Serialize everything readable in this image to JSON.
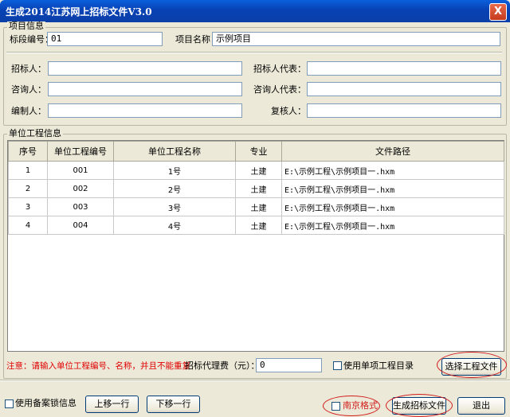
{
  "window": {
    "title": "生成2014江苏网上招标文件V3.0",
    "close_glyph": "X"
  },
  "project_info": {
    "legend": "项目信息",
    "section_no_label": "标段编号：",
    "section_no_value": "01",
    "project_name_label": "项目名称：",
    "project_name_value": "示例项目",
    "tenderer_label": "招标人：",
    "tenderer_value": "",
    "tenderer_rep_label": "招标人代表：",
    "tenderer_rep_value": "",
    "consultant_label": "咨询人：",
    "consultant_value": "",
    "consultant_rep_label": "咨询人代表：",
    "consultant_rep_value": "",
    "compiler_label": "编制人：",
    "compiler_value": "",
    "reviewer_label": "复核人：",
    "reviewer_value": ""
  },
  "unit_info": {
    "legend": "单位工程信息",
    "columns": [
      "序号",
      "单位工程编号",
      "单位工程名称",
      "专业",
      "文件路径"
    ],
    "rows": [
      [
        "1",
        "001",
        "1号",
        "土建",
        "E:\\示例工程\\示例项目一.hxm"
      ],
      [
        "2",
        "002",
        "2号",
        "土建",
        "E:\\示例工程\\示例项目一.hxm"
      ],
      [
        "3",
        "003",
        "3号",
        "土建",
        "E:\\示例工程\\示例项目一.hxm"
      ],
      [
        "4",
        "004",
        "4号",
        "土建",
        "E:\\示例工程\\示例项目一.hxm"
      ]
    ],
    "warning": "注意：请输入单位工程编号、名称，并且不能重复",
    "agency_fee_label": "招标代理费（元）：",
    "agency_fee_value": "0",
    "use_single_catalog_label": "使用单项工程目录",
    "select_file_button": "选择工程文件"
  },
  "bottom": {
    "use_record_lock_label": "使用备案锁信息",
    "move_up_button": "上移一行",
    "move_down_button": "下移一行",
    "nanjing_format_label": "南京格式",
    "generate_button": "生成招标文件",
    "exit_button": "退出"
  },
  "colors": {
    "title_bar": "#0842b4",
    "warning_text": "#e00000",
    "highlight_ellipse": "#d21c1c"
  }
}
